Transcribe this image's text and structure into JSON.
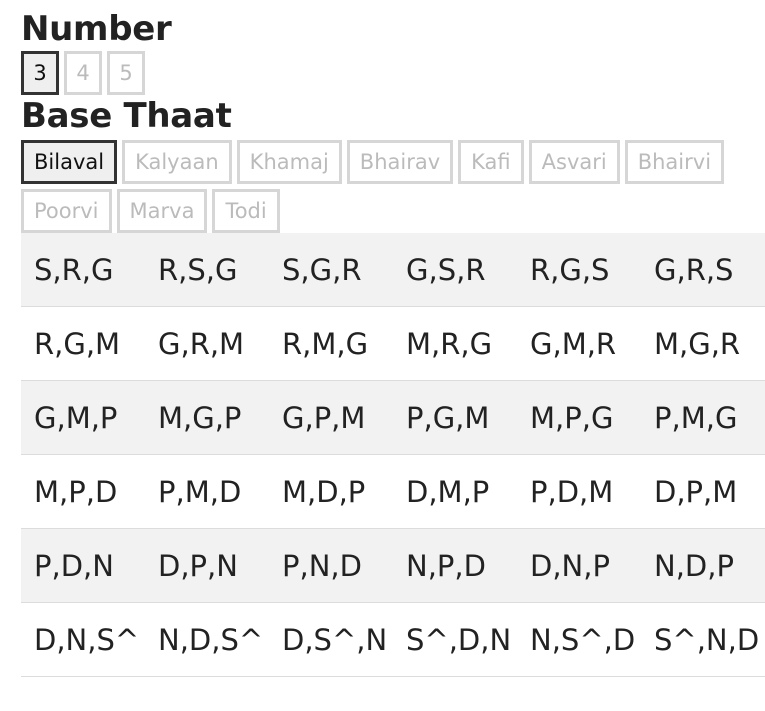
{
  "number_section": {
    "heading": "Number",
    "options": [
      "3",
      "4",
      "5"
    ],
    "selected_index": 0
  },
  "thaat_section": {
    "heading": "Base Thaat",
    "options": [
      "Bilaval",
      "Kalyaan",
      "Khamaj",
      "Bhairav",
      "Kafi",
      "Asvari",
      "Bhairvi",
      "Poorvi",
      "Marva",
      "Todi"
    ],
    "selected_index": 0
  },
  "table": {
    "rows": [
      [
        "S,R,G",
        "R,S,G",
        "S,G,R",
        "G,S,R",
        "R,G,S",
        "G,R,S"
      ],
      [
        "R,G,M",
        "G,R,M",
        "R,M,G",
        "M,R,G",
        "G,M,R",
        "M,G,R"
      ],
      [
        "G,M,P",
        "M,G,P",
        "G,P,M",
        "P,G,M",
        "M,P,G",
        "P,M,G"
      ],
      [
        "M,P,D",
        "P,M,D",
        "M,D,P",
        "D,M,P",
        "P,D,M",
        "D,P,M"
      ],
      [
        "P,D,N",
        "D,P,N",
        "P,N,D",
        "N,P,D",
        "D,N,P",
        "N,D,P"
      ],
      [
        "D,N,S^",
        "N,D,S^",
        "D,S^,N",
        "S^,D,N",
        "N,S^,D",
        "S^,N,D"
      ]
    ]
  },
  "colors": {
    "selected_border": "#333333",
    "unselected_border": "#d6d6d6",
    "unselected_text": "#bbbbbb",
    "stripe": "#f2f2f2"
  }
}
